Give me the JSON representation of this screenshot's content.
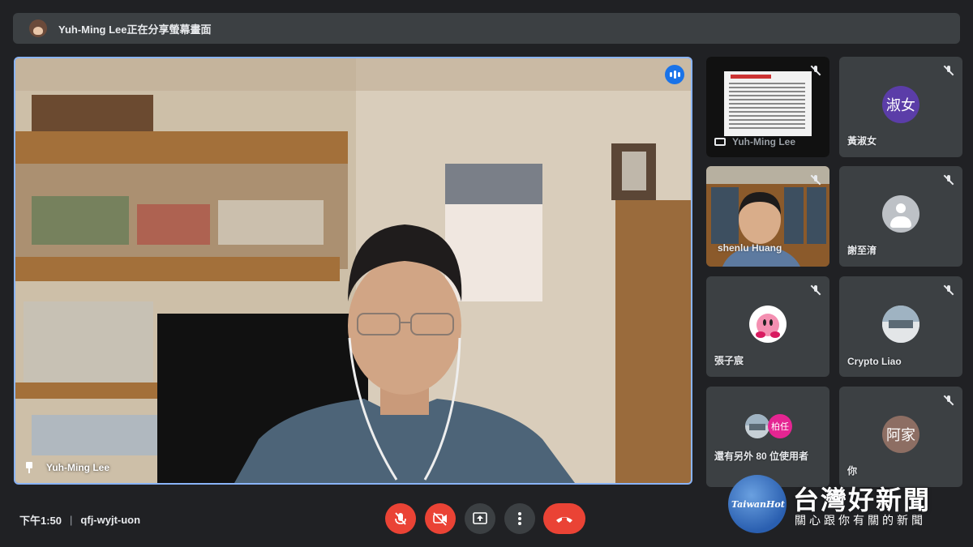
{
  "banner": {
    "text": "Yuh-Ming Lee正在分享螢幕畫面"
  },
  "stage": {
    "speaker_name": "Yuh-Ming Lee"
  },
  "participants": [
    {
      "id": "screen-share",
      "name": "Yuh-Ming Lee",
      "type": "screen",
      "muted": true
    },
    {
      "id": "shuen",
      "name": "黃淑女",
      "type": "avatar-text",
      "avatar_text": "淑女",
      "avatar_color": "#5b3da8",
      "muted": true
    },
    {
      "id": "shenlu",
      "name": "shenlu Huang",
      "type": "video",
      "muted": true
    },
    {
      "id": "hsieh",
      "name": "謝至淯",
      "type": "generic",
      "muted": true
    },
    {
      "id": "chang",
      "name": "張子宸",
      "type": "image",
      "muted": true
    },
    {
      "id": "crypto",
      "name": "Crypto Liao",
      "type": "image",
      "muted": true
    },
    {
      "id": "more",
      "name": "還有另外 80 位使用者",
      "type": "group",
      "avatar_text": "柏任",
      "avatar_color": "#e52592",
      "muted": false
    },
    {
      "id": "you",
      "name": "你",
      "type": "avatar-text",
      "avatar_text": "阿家",
      "avatar_color": "#8d6e63",
      "muted": true
    }
  ],
  "bottom": {
    "time": "下午1:50",
    "meeting_code": "qfj-wyjt-uon"
  },
  "controls": {
    "mic": "mic-off-icon",
    "camera": "camera-off-icon",
    "present": "present-screen-icon",
    "more": "more-options-icon",
    "leave": "leave-call-icon"
  },
  "watermark": {
    "brand": "TaiwanHot",
    "title": "台灣好新聞",
    "subtitle": "關心跟你有關的新聞"
  },
  "colors": {
    "background": "#202124",
    "tile": "#3c4043",
    "active_speaker_border": "#8ab4f8",
    "danger": "#ea4335"
  }
}
